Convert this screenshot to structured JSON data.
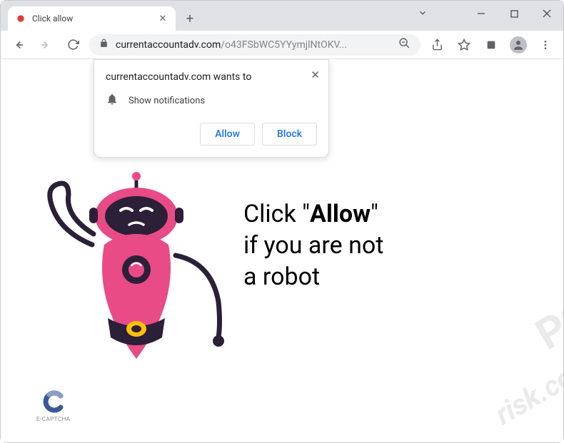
{
  "window": {
    "tab_title": "Click allow",
    "minimize": "—",
    "maximize": "☐",
    "close": "✕"
  },
  "toolbar": {
    "url_domain": "currentaccountadv.com",
    "url_path": "/o43FSbWC5YYymjlNtOKV..."
  },
  "permission": {
    "title": "currentaccountadv.com wants to",
    "capability": "Show notifications",
    "allow_label": "Allow",
    "block_label": "Block"
  },
  "page": {
    "msg_line1_pre": "Click \"",
    "msg_line1_bold": "Allow",
    "msg_line1_post": "\"",
    "msg_line2": "if you are not",
    "msg_line3": "a robot",
    "captcha_label": "E-CAPTCHA"
  },
  "watermark": {
    "line1": "PC",
    "line2": "risk.com"
  }
}
